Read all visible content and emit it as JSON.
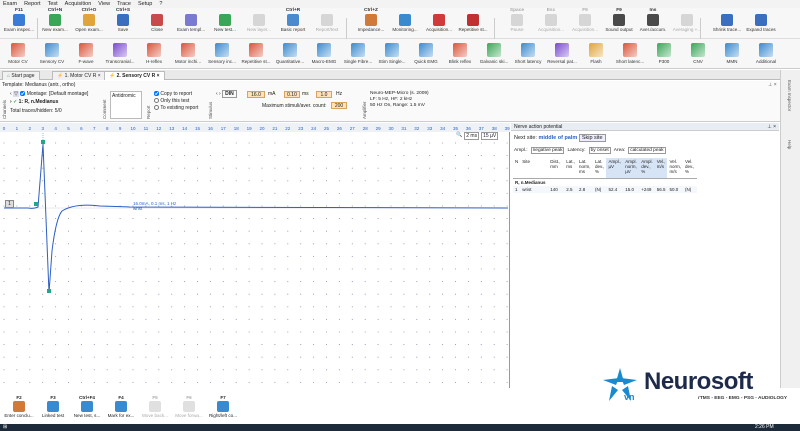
{
  "menu": [
    "Exam",
    "Report",
    "Test",
    "Acquisition",
    "View",
    "Trace",
    "Setup",
    "?"
  ],
  "ribbon_top": [
    {
      "shortcut": "F11",
      "label": "Exam inspec...",
      "icon": "exam-inspector-icon",
      "color": "#3a7bd5",
      "enabled": true
    },
    {
      "shortcut": "Ctrl+N",
      "label": "New exam...",
      "icon": "new-exam-icon",
      "color": "#3aa657",
      "enabled": true
    },
    {
      "shortcut": "Ctrl+O",
      "label": "Open exam...",
      "icon": "open-exam-icon",
      "color": "#e0a43a",
      "enabled": true
    },
    {
      "shortcut": "Ctrl+S",
      "label": "Save",
      "icon": "save-icon",
      "color": "#3a6fc0",
      "enabled": true
    },
    {
      "shortcut": "",
      "label": "Close",
      "icon": "close-exam-icon",
      "color": "#c84a4a",
      "enabled": true
    },
    {
      "shortcut": "",
      "label": "Exam templ...",
      "icon": "exam-template-icon",
      "color": "#7a7ad0",
      "enabled": true
    },
    {
      "shortcut": "",
      "label": "New test...",
      "icon": "new-test-icon",
      "color": "#3aa657",
      "enabled": true
    },
    {
      "shortcut": "",
      "label": "New layer...",
      "icon": "new-layer-icon",
      "color": "#999999",
      "enabled": false
    },
    {
      "shortcut": "Ctrl+R",
      "label": "Basic report",
      "icon": "basic-report-icon",
      "color": "#4a8bd0",
      "enabled": true
    },
    {
      "shortcut": "",
      "label": "Report/text",
      "icon": "report-text-icon",
      "color": "#999999",
      "enabled": false
    },
    {
      "shortcut": "Ctrl+Z",
      "label": "Impedance...",
      "icon": "impedance-icon",
      "color": "#d07a3a",
      "enabled": true
    },
    {
      "shortcut": "",
      "label": "Monitoring...",
      "icon": "monitoring-icon",
      "color": "#3a8ad0",
      "enabled": true
    },
    {
      "shortcut": "",
      "label": "Acquisition...",
      "icon": "acquisition-icon",
      "color": "#d03a3a",
      "enabled": true
    },
    {
      "shortcut": "",
      "label": "Repetitive st...",
      "icon": "repetitive-stim-icon",
      "color": "#c03030",
      "enabled": true
    },
    {
      "shortcut": "Space",
      "label": "Pause",
      "icon": "pause-icon",
      "color": "#999999",
      "enabled": false
    },
    {
      "shortcut": "Esc",
      "label": "Acquisition...",
      "icon": "stop-acquisition-icon",
      "color": "#999999",
      "enabled": false
    },
    {
      "shortcut": "F9",
      "label": "Acquisition...",
      "icon": "acquisition-settings-icon",
      "color": "#999999",
      "enabled": false
    },
    {
      "shortcut": "F9",
      "label": "Sound output",
      "icon": "sound-output-icon",
      "color": "#4a4a4a",
      "enabled": true
    },
    {
      "shortcut": "Ins",
      "label": "Aver./accum.",
      "icon": "average-accumulate-icon",
      "color": "#4a4a4a",
      "enabled": true
    },
    {
      "shortcut": "",
      "label": "Averaging +...",
      "icon": "averaging-plus-icon",
      "color": "#999999",
      "enabled": false
    },
    {
      "shortcut": "",
      "label": "Shrink trace...",
      "icon": "shrink-trace-icon",
      "color": "#3a6fc0",
      "enabled": true
    },
    {
      "shortcut": "",
      "label": "Expand traces",
      "icon": "expand-traces-icon",
      "color": "#3a6fc0",
      "enabled": true
    }
  ],
  "ribbon_tests": [
    {
      "label": "Motor CV",
      "icon": "motor-cv-icon",
      "color": "#d9543a"
    },
    {
      "label": "Sensory CV",
      "icon": "sensory-cv-icon",
      "color": "#3a8ad0"
    },
    {
      "label": "F-wave",
      "icon": "f-wave-icon",
      "color": "#d9543a"
    },
    {
      "label": "Transcranial...",
      "icon": "transcranial-icon",
      "color": "#7a4ad0"
    },
    {
      "label": "H-reflex",
      "icon": "h-reflex-icon",
      "color": "#d9543a"
    },
    {
      "label": "Motor inchi...",
      "icon": "motor-inching-icon",
      "color": "#d9543a"
    },
    {
      "label": "Sensory inc...",
      "icon": "sensory-inching-icon",
      "color": "#3a8ad0"
    },
    {
      "label": "Repetitive st...",
      "icon": "repetitive-stimulation-icon",
      "color": "#d9543a"
    },
    {
      "label": "Quantitative...",
      "icon": "quantitative-emg-icon",
      "color": "#3a8ad0"
    },
    {
      "label": "Macro-EMG",
      "icon": "macro-emg-icon",
      "color": "#3a8ad0"
    },
    {
      "label": "Single Fibre...",
      "icon": "single-fibre-icon",
      "color": "#3a8ad0"
    },
    {
      "label": "Stim Single...",
      "icon": "stim-single-icon",
      "color": "#3a8ad0"
    },
    {
      "label": "Quick EMG",
      "icon": "quick-emg-icon",
      "color": "#3a8ad0"
    },
    {
      "label": "Blink reflex",
      "icon": "blink-reflex-icon",
      "color": "#d9543a"
    },
    {
      "label": "Galvanic ski...",
      "icon": "galvanic-skin-icon",
      "color": "#3aa657"
    },
    {
      "label": "Short latency",
      "icon": "short-latency-icon",
      "color": "#3a8ad0"
    },
    {
      "label": "Reversal pat...",
      "icon": "reversal-pattern-icon",
      "color": "#7a4ad0"
    },
    {
      "label": "Flash",
      "icon": "flash-icon",
      "color": "#e0a43a"
    },
    {
      "label": "Short latenc...",
      "icon": "short-latency-2-icon",
      "color": "#d9543a"
    },
    {
      "label": "P300",
      "icon": "p300-icon",
      "color": "#3aa657"
    },
    {
      "label": "CNV",
      "icon": "cnv-icon",
      "color": "#3aa657"
    },
    {
      "label": "MMN",
      "icon": "mmn-icon",
      "color": "#3a8ad0"
    },
    {
      "label": "Additional",
      "icon": "additional-icon",
      "color": "#3a8ad0"
    }
  ],
  "tabs": [
    "Start page",
    "1. Motor CV R",
    "2. Sensory CV R"
  ],
  "template_label": "Template: Medianus (antr., ortho)",
  "channel": {
    "section_label": "Channels",
    "montage": "Montage: [Default montage]",
    "nerve": "1: R, n.Medianus",
    "total": "Total traces/hidden: 5/0"
  },
  "comment": {
    "section_label": "Comment",
    "value": "Antidromic"
  },
  "report": {
    "section_label": "Report",
    "copy_to_report": "Copy to report",
    "only_this_test": "Only this test",
    "to_existing": "To existing report"
  },
  "stimulus": {
    "section_label": "Stimulus",
    "mode": "DIN",
    "current": "16.0",
    "current_unit": "mA",
    "duration": "0.10",
    "duration_unit": "ms",
    "freq": "1.0",
    "freq_unit": "Hz",
    "max_stimuli_label": "Maximum stimuli/aver. count:",
    "max_stimuli": "200"
  },
  "amplifier": {
    "section_label": "Amplifier",
    "device": "Neuro-MEP-Micro (s. 2009)",
    "filters": "LF: 5 Hz, HF: 2 kHz",
    "notch": "50 Hz  On, Range: 1.5 mV"
  },
  "chart": {
    "ruler": [
      "0",
      "1",
      "2",
      "3",
      "4",
      "5",
      "6",
      "7",
      "8",
      "9",
      "10",
      "11",
      "12",
      "13",
      "14",
      "15",
      "16",
      "17",
      "18",
      "19",
      "20",
      "21",
      "22",
      "23",
      "24",
      "25",
      "26",
      "27",
      "28",
      "29",
      "30",
      "31",
      "32",
      "33",
      "34",
      "35",
      "36",
      "37",
      "38",
      "39"
    ],
    "sweep": "2 ms",
    "sensitivity": "15 µV",
    "trace_label": "1",
    "trace_annotation": "16.0mA, 0.1 ms, 1 Hz",
    "trace_annotation2": "wrist",
    "trace_color": "#2d5fc2",
    "marker_color": "#1fa88a"
  },
  "results": {
    "title": "Nerve action potential",
    "next_site_label": "Next site:",
    "next_site": "middle of palm",
    "skip_site": "Skip site",
    "ampl_label": "Ampl.:",
    "ampl_value": "negative peak",
    "latency_label": "Latency:",
    "latency_value": "by onset",
    "area_label": "Area:",
    "area_value": "calculated peak",
    "columns": [
      "N",
      "Site",
      "Dist., mm",
      "Lat., ms",
      "Lat. norm, ms",
      "Lat. dev., %",
      "Ampl., µV",
      "Ampl. norm, µV",
      "Ampl. dev., %",
      "Vel., m/s",
      "Vel. norm, m/s",
      "Vel. dev., %"
    ],
    "group": "R, n.Medianus",
    "rows": [
      [
        "1",
        "wrist",
        "140",
        "2.5",
        "2.8",
        "(N)",
        "52.4",
        "15.0",
        "+249",
        "56.5",
        "50.0",
        "(N)"
      ]
    ]
  },
  "sidebar": [
    "Exam Inspector",
    "Help"
  ],
  "fkeys": [
    {
      "key": "F2",
      "label": "Enter conclu...",
      "icon": "conclusion-icon",
      "color": "#d07a3a",
      "enabled": true
    },
    {
      "key": "F3",
      "label": "Linked test",
      "icon": "linked-test-icon",
      "color": "#3a8ad0",
      "enabled": true
    },
    {
      "key": "Ctrl+F4",
      "label": "New test, s...",
      "icon": "new-test-same-icon",
      "color": "#3a8ad0",
      "enabled": true
    },
    {
      "key": "F4",
      "label": "Mark for ex...",
      "icon": "mark-for-exclusion-icon",
      "color": "#3a8ad0",
      "enabled": true
    },
    {
      "key": "F5",
      "label": "Move back...",
      "icon": "move-back-icon",
      "color": "#999999",
      "enabled": false
    },
    {
      "key": "F6",
      "label": "Move forwa...",
      "icon": "move-forward-icon",
      "color": "#999999",
      "enabled": false
    },
    {
      "key": "F7",
      "label": "Right/left co...",
      "icon": "right-left-compare-icon",
      "color": "#3a8ad0",
      "enabled": true
    }
  ],
  "brand": {
    "name": "Neurosoft",
    "sub": "vn",
    "tagline": "rTMS - EEG - EMG - PSG - AUDIOLOGY"
  },
  "clock": "2:26 PM"
}
